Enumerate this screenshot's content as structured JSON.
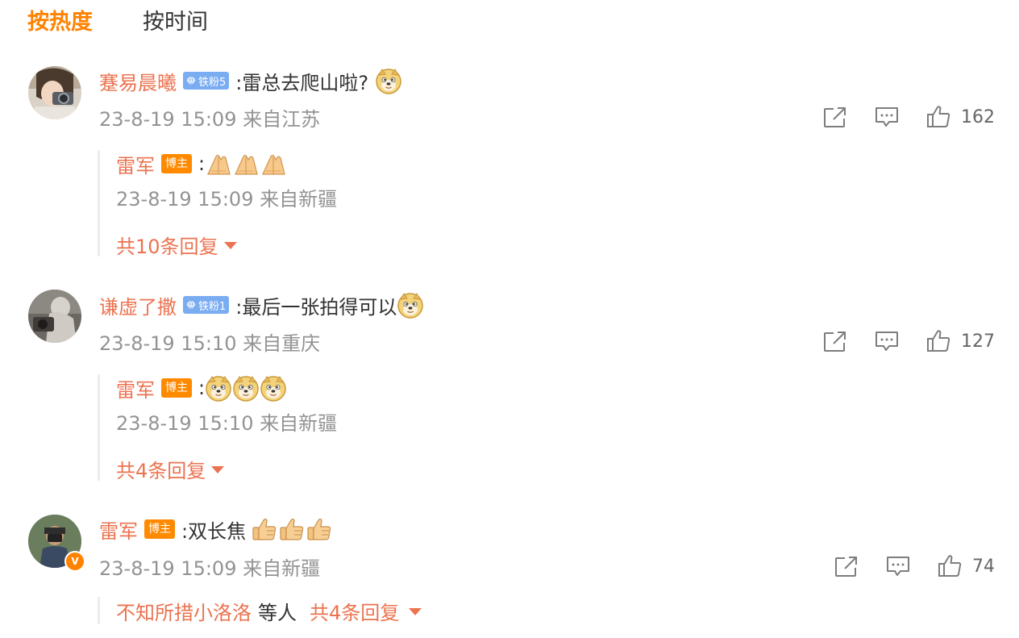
{
  "tabs": [
    {
      "label": "按热度",
      "active": true
    },
    {
      "label": "按时间",
      "active": false
    }
  ],
  "colors": {
    "accent": "#ff8200",
    "username": "#eb7350",
    "meta": "#939393",
    "fan_badge": "#7aacf2",
    "host_badge": "#ff8a00"
  },
  "comments": [
    {
      "user": "蹇易晨曦",
      "fan_badge": "铁粉5",
      "text": ":雷总去爬山啦?",
      "emojis": [
        "doge"
      ],
      "meta": "23-8-19 15:09 来自江苏",
      "likes": "162",
      "reply": {
        "user": "雷军",
        "badge": "博主",
        "text": ":",
        "emojis": [
          "pray",
          "pray",
          "pray"
        ],
        "meta": "23-8-19 15:09 来自新疆",
        "more": "共10条回复"
      }
    },
    {
      "user": "谦虚了撒",
      "fan_badge": "铁粉1",
      "text": ":最后一张拍得可以",
      "emojis": [
        "doge"
      ],
      "meta": "23-8-19 15:10 来自重庆",
      "likes": "127",
      "reply": {
        "user": "雷军",
        "badge": "博主",
        "text": ":",
        "emojis": [
          "doge",
          "doge",
          "doge"
        ],
        "meta": "23-8-19 15:10 来自新疆",
        "more": "共4条回复"
      }
    },
    {
      "user": "雷军",
      "host_badge": "博主",
      "verified_mark": "V",
      "text": ":双长焦",
      "emojis": [
        "thumbs-up",
        "thumbs-up",
        "thumbs-up"
      ],
      "meta": "23-8-19 15:09 来自新疆",
      "likes": "74",
      "summary": {
        "names": "不知所措小洛洛",
        "suffix": "等人",
        "more": "共4条回复"
      }
    }
  ]
}
